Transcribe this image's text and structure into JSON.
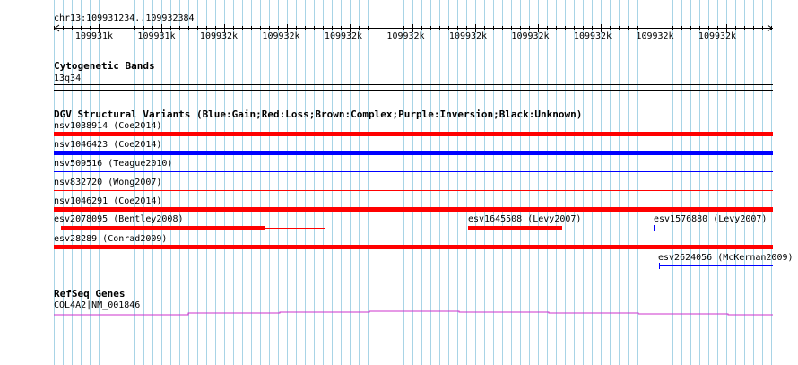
{
  "ruler": {
    "location": "chr13:109931234..109932384",
    "ticks": [
      "109931k",
      "109931k",
      "109932k",
      "109932k",
      "109932k",
      "109932k",
      "109932k",
      "109932k",
      "109932k",
      "109932k",
      "109932k"
    ]
  },
  "cytobands": {
    "title": "Cytogenetic Bands",
    "band_label": "13q34"
  },
  "dgv": {
    "title": "DGV Structural Variants (Blue:Gain;Red:Loss;Brown:Complex;Purple:Inversion;Black:Unknown)",
    "items": [
      {
        "label": "nsv1038914 (Coe2014)",
        "color": "#ff0000"
      },
      {
        "label": "nsv1046423 (Coe2014)",
        "color": "#0000ff"
      },
      {
        "label": "nsv509516 (Teague2010)",
        "color": "#0000ff"
      },
      {
        "label": "nsv832720 (Wong2007)",
        "color": "#ff0000"
      },
      {
        "label": "nsv1046291 (Coe2014)",
        "color": "#ff0000"
      },
      {
        "label": "esv2078095 (Bentley2008)",
        "color": "#ff0000"
      },
      {
        "label": "esv1645508 (Levy2007)",
        "color": "#ff0000"
      },
      {
        "label": "esv1576880 (Levy2007)",
        "color": "#0000ff"
      },
      {
        "label": "esv28289 (Conrad2009)",
        "color": "#ff0000"
      },
      {
        "label": "esv2624056 (McKernan2009)",
        "color": "#0000ff"
      }
    ]
  },
  "refseq": {
    "title": "RefSeq Genes",
    "gene_label": "COL4A2|NM_001846",
    "color": "#cc33cc"
  },
  "colors": {
    "grid": "#a8d4e6",
    "gain": "#0000ff",
    "loss": "#ff0000"
  }
}
